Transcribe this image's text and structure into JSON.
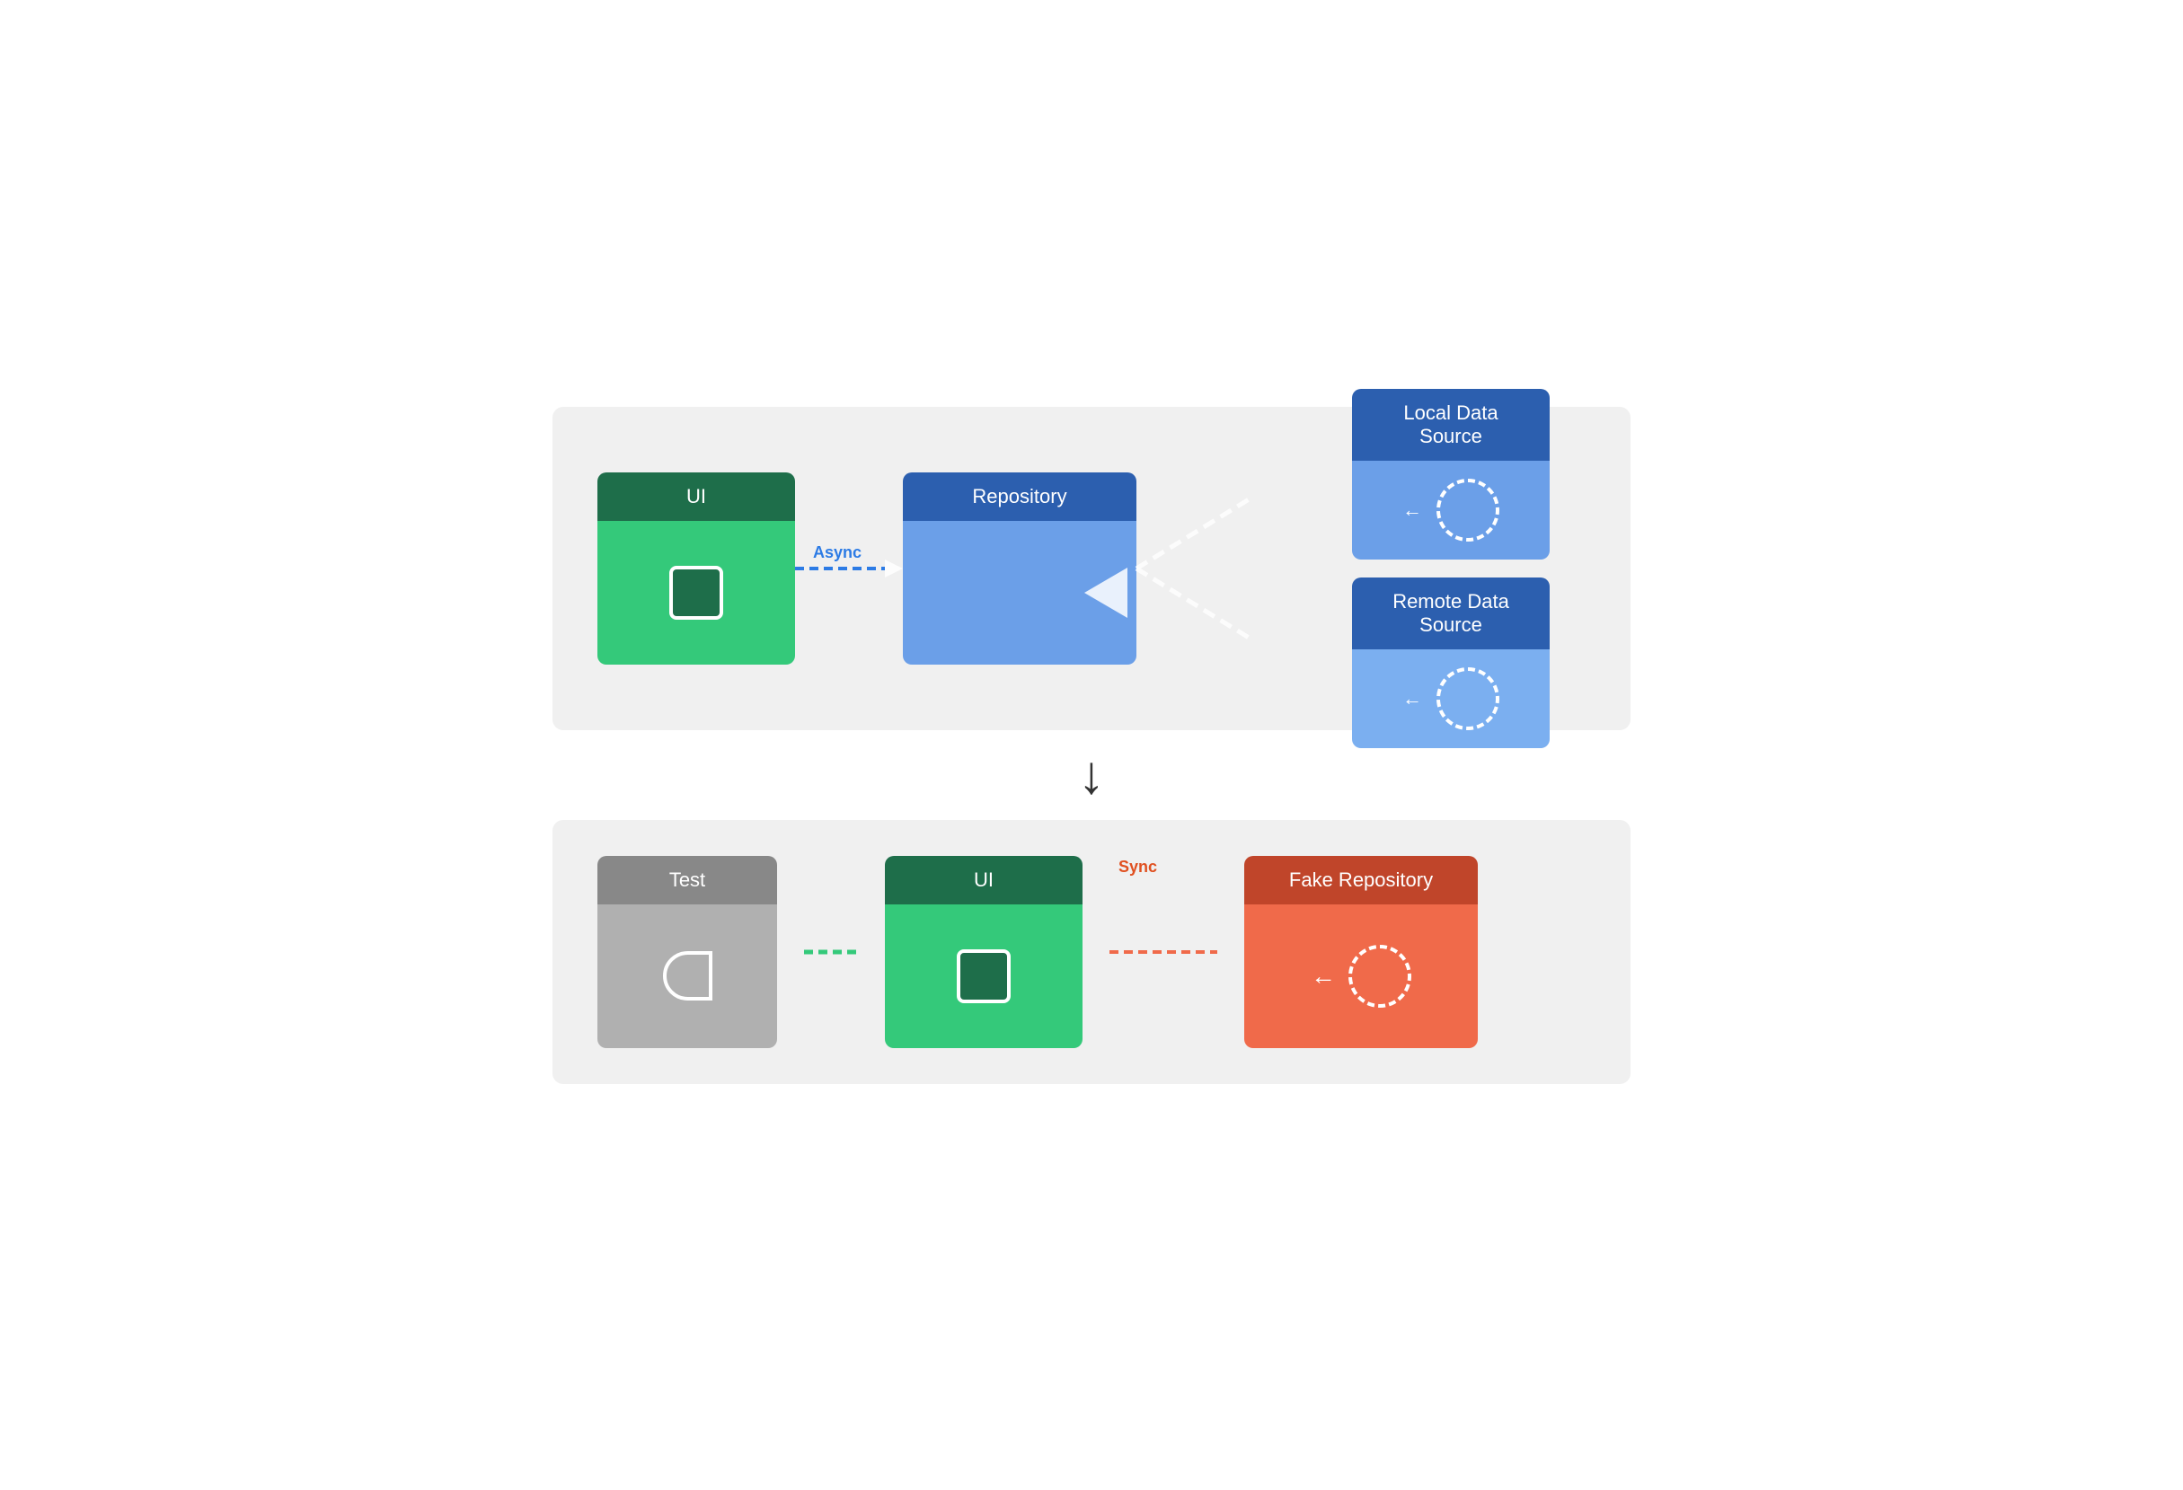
{
  "top_diagram": {
    "ui_label": "UI",
    "repo_label": "Repository",
    "local_ds_label": "Local Data Source",
    "remote_ds_label": "Remote Data Source",
    "async_label": "Async"
  },
  "bottom_diagram": {
    "test_label": "Test",
    "ui_label": "UI",
    "fake_repo_label": "Fake Repository",
    "sync_label": "Sync"
  },
  "arrow_down": "↓"
}
